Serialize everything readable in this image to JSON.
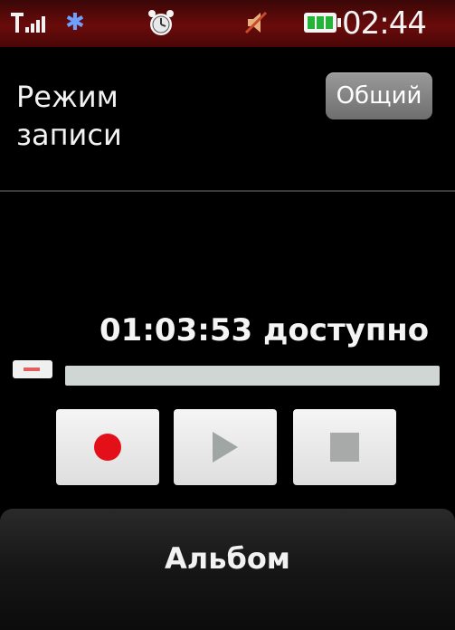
{
  "status_bar": {
    "signal_icon": "signal-strength-icon",
    "bluetooth_icon": "bluetooth-icon",
    "bluetooth_glyph": "✱",
    "alarm_icon": "alarm-clock-icon",
    "speaker_icon": "speaker-icon",
    "battery_icon": "battery-icon",
    "time": "02:44"
  },
  "header": {
    "title": "Режим\nзаписи",
    "mode_button_label": "Общий"
  },
  "recorder": {
    "time_available": "01:03:53 доступно",
    "progress_fraction": 0.0,
    "record_icon": "record-icon",
    "play_icon": "play-icon",
    "stop_icon": "stop-icon"
  },
  "footer": {
    "album_label": "Альбом"
  },
  "colors": {
    "status_bar_bg": "#6a0b0b",
    "record_red": "#e3101a",
    "progress_track": "#cfd6d4"
  }
}
